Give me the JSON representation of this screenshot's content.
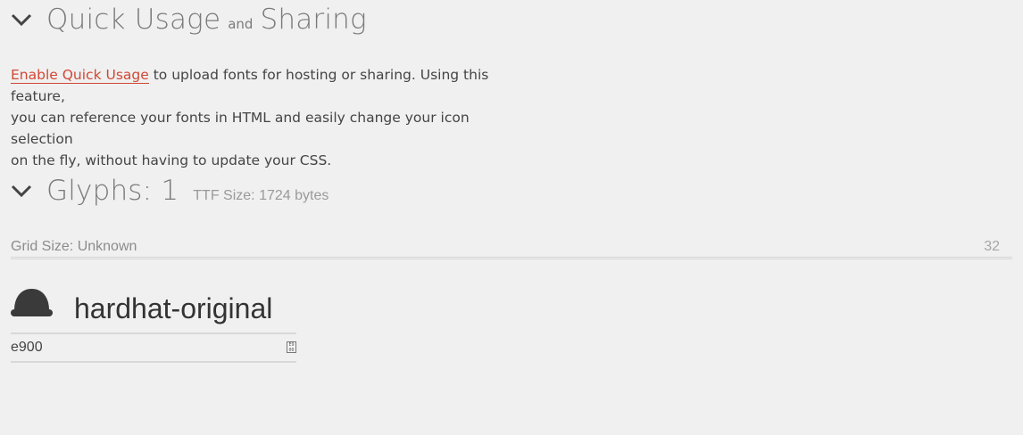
{
  "quick_usage": {
    "title_part1": "Quick Usage",
    "title_connector": "and",
    "title_part2": "Sharing",
    "enable_link": "Enable Quick Usage",
    "description_line1": " to upload fonts for hosting or sharing. Using this feature,",
    "description_line2": "you can reference your fonts in HTML and easily change your icon selection",
    "description_line3": "on the fly, without having to update your CSS."
  },
  "glyphs": {
    "title": "Glyphs: 1",
    "ttf_size": "TTF Size: 1724 bytes"
  },
  "grid": {
    "label": "Grid Size: Unknown",
    "value": "32"
  },
  "glyph_items": [
    {
      "name": "hardhat-original",
      "code": "e900",
      "toggle_label": "E9\n00"
    }
  ],
  "colors": {
    "link": "#d14836",
    "icon": "#3a3a3a",
    "background": "#f0f0f0"
  },
  "icons": {
    "section_toggle": "chevron-down-icon",
    "glyph": "hardhat-icon",
    "code_toggle": "hex-code-icon"
  }
}
